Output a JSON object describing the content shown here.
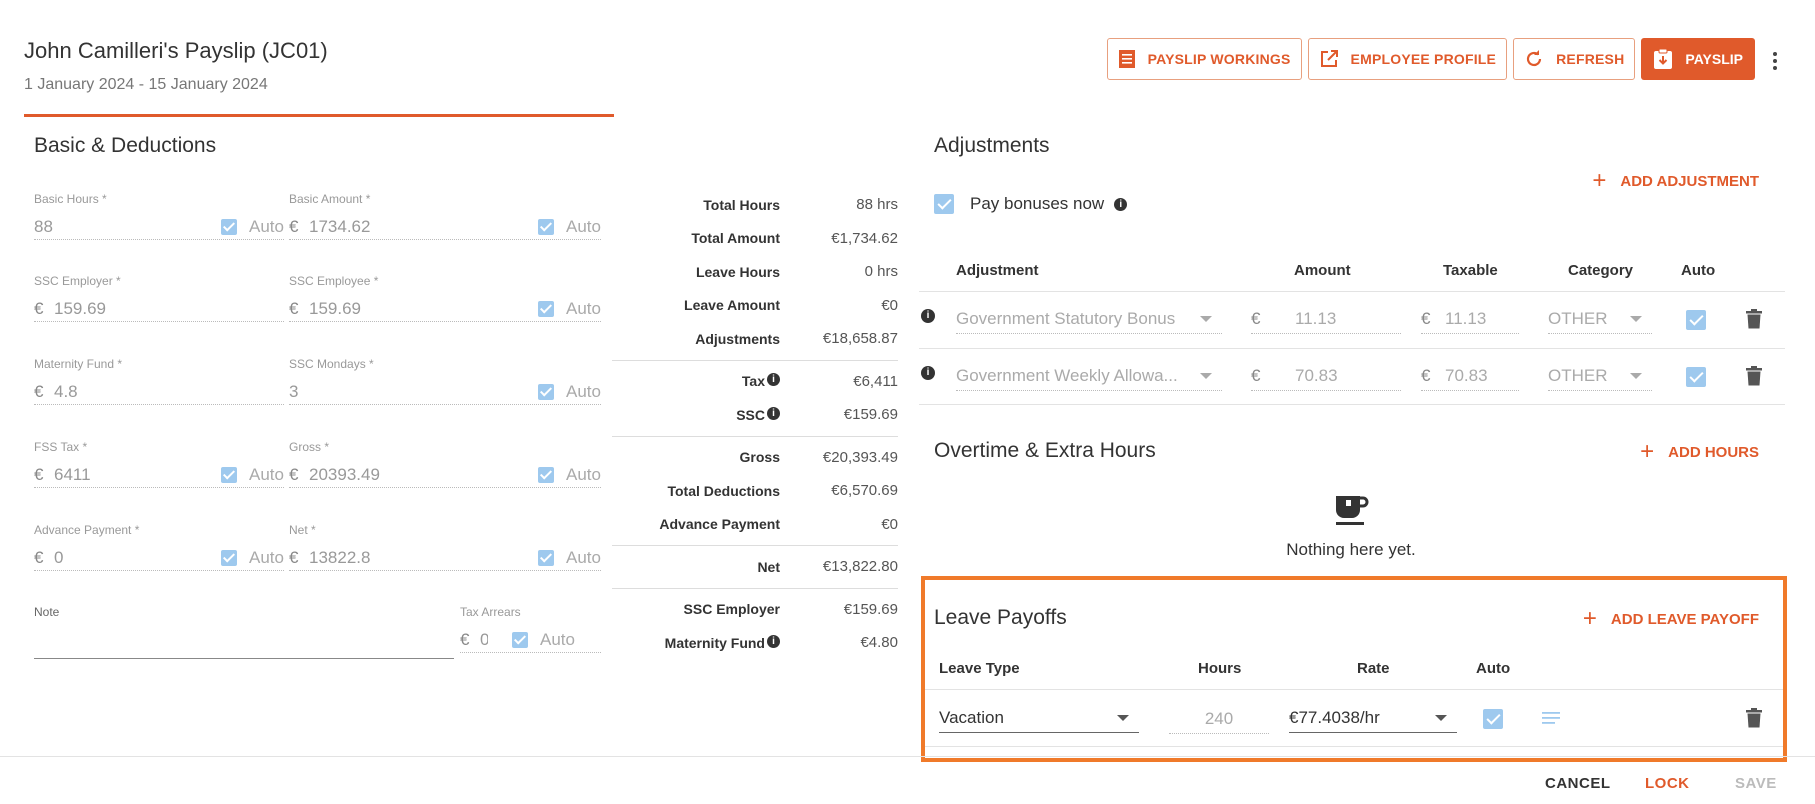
{
  "header": {
    "title": "John Camilleri's Payslip (JC01)",
    "period": "1 January 2024 - 15 January 2024"
  },
  "actions": {
    "payslip_workings": "PAYSLIP WORKINGS",
    "employee_profile": "EMPLOYEE PROFILE",
    "refresh": "REFRESH",
    "payslip": "PAYSLIP"
  },
  "basic": {
    "title": "Basic & Deductions",
    "auto_label": "Auto",
    "currency": "€",
    "fields": {
      "basic_hours": {
        "label": "Basic Hours *",
        "value": "88"
      },
      "basic_amount": {
        "label": "Basic Amount *",
        "value": "1734.62"
      },
      "ssc_employer": {
        "label": "SSC Employer *",
        "value": "159.69"
      },
      "ssc_employee": {
        "label": "SSC Employee *",
        "value": "159.69"
      },
      "maternity_fund": {
        "label": "Maternity Fund *",
        "value": "4.8"
      },
      "ssc_mondays": {
        "label": "SSC Mondays *",
        "value": "3"
      },
      "fss_tax": {
        "label": "FSS Tax *",
        "value": "6411"
      },
      "gross": {
        "label": "Gross *",
        "value": "20393.49"
      },
      "advance_payment": {
        "label": "Advance Payment *",
        "value": "0"
      },
      "net": {
        "label": "Net *",
        "value": "13822.8"
      },
      "note": {
        "label": "Note",
        "value": ""
      },
      "tax_arrears": {
        "label": "Tax Arrears",
        "value": "0"
      }
    }
  },
  "summary": {
    "total_hours": {
      "k": "Total Hours",
      "v": "88 hrs"
    },
    "total_amount": {
      "k": "Total Amount",
      "v": "€1,734.62"
    },
    "leave_hours": {
      "k": "Leave Hours",
      "v": "0 hrs"
    },
    "leave_amount": {
      "k": "Leave Amount",
      "v": "€0"
    },
    "adjustments": {
      "k": "Adjustments",
      "v": "€18,658.87"
    },
    "tax": {
      "k": "Tax",
      "v": "€6,411"
    },
    "ssc": {
      "k": "SSC",
      "v": "€159.69"
    },
    "gross": {
      "k": "Gross",
      "v": "€20,393.49"
    },
    "total_deductions": {
      "k": "Total Deductions",
      "v": "€6,570.69"
    },
    "advance_payment": {
      "k": "Advance Payment",
      "v": "€0"
    },
    "net": {
      "k": "Net",
      "v": "€13,822.80"
    },
    "ssc_employer": {
      "k": "SSC Employer",
      "v": "€159.69"
    },
    "maternity_fund": {
      "k": "Maternity Fund",
      "v": "€4.80"
    }
  },
  "adjustments": {
    "title": "Adjustments",
    "add_label": "ADD ADJUSTMENT",
    "pay_bonuses": "Pay bonuses now",
    "columns": {
      "adjustment": "Adjustment",
      "amount": "Amount",
      "taxable": "Taxable",
      "category": "Category",
      "auto": "Auto"
    },
    "rows": [
      {
        "name": "Government Statutory Bonus",
        "currency": "€",
        "amount": "11.13",
        "taxable": "11.13",
        "category": "OTHER"
      },
      {
        "name": "Government Weekly Allowa...",
        "currency": "€",
        "amount": "70.83",
        "taxable": "70.83",
        "category": "OTHER"
      }
    ]
  },
  "overtime": {
    "title": "Overtime & Extra Hours",
    "add_label": "ADD HOURS",
    "empty_text": "Nothing here yet."
  },
  "leave": {
    "title": "Leave Payoffs",
    "add_label": "ADD LEAVE PAYOFF",
    "columns": {
      "type": "Leave Type",
      "hours": "Hours",
      "rate": "Rate",
      "auto": "Auto"
    },
    "row": {
      "type": "Vacation",
      "hours": "240",
      "rate": "€77.4038/hr"
    }
  },
  "footer": {
    "cancel": "CANCEL",
    "lock": "LOCK",
    "save": "SAVE"
  },
  "colors": {
    "accent": "#e05a2b",
    "checkbox": "#9ec9ee",
    "highlight": "#f07a2a"
  }
}
